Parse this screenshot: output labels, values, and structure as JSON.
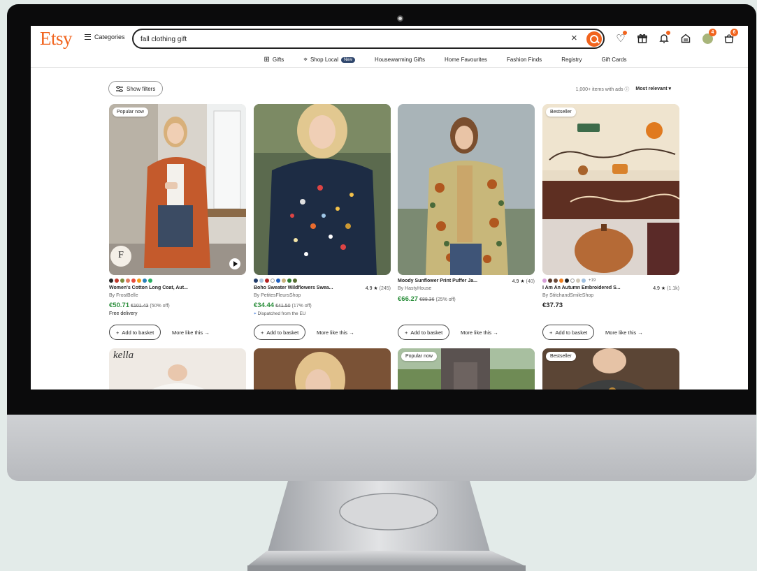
{
  "header": {
    "logo": "Etsy",
    "categories_label": "Categories",
    "search_value": "fall clothing gift",
    "clear_glyph": "×",
    "notif_badge": "4",
    "cart_badge": "6"
  },
  "nav": [
    {
      "label": "Gifts",
      "icon": "gift-icon"
    },
    {
      "label": "Shop Local",
      "icon": "location-pin-icon",
      "pill": "New"
    },
    {
      "label": "Housewarming Gifts"
    },
    {
      "label": "Home Favourites"
    },
    {
      "label": "Fashion Finds"
    },
    {
      "label": "Registry"
    },
    {
      "label": "Gift Cards"
    }
  ],
  "toolbar": {
    "filters_label": "Show filters",
    "results_text": "1,000+ items with ads ⓘ",
    "sort_label": "Most relevant ▾"
  },
  "buttons": {
    "add_label": "Add to basket",
    "more_label": "More like this →"
  },
  "products": [
    {
      "tag": "Popular now",
      "title": "Women's Cotton Long Coat, Aut...",
      "rating": "",
      "count": "",
      "shop": "By FrostBelle",
      "price": "€50.71",
      "old_price": "€101.43",
      "discount": "(50% off)",
      "extra": "Free delivery",
      "seal_letter": "F",
      "swatches": [
        "#222222",
        "#c0392b",
        "#7a8b3d",
        "#e07a5f",
        "#e74c3c",
        "#f39c12",
        "#2980b9",
        "#27ae60"
      ]
    },
    {
      "tag": "",
      "title": "Boho Sweater Wildflowers Swea...",
      "rating": "4.9 ★",
      "count": "(245)",
      "shop": "By PetitesFleursShop",
      "price": "€34.44",
      "old_price": "€41.50",
      "discount": "(17% off)",
      "extra": "Dispatched from the EU",
      "swatches": [
        "#1f3a68",
        "#a8c6e0",
        "#b22222",
        "#ffffff",
        "#1e5fbf",
        "#c9b27c",
        "#2e7d32",
        "#556b2f"
      ]
    },
    {
      "tag": "",
      "title": "Moody Sunflower Print Puffer Ja...",
      "rating": "4.9 ★",
      "count": "(40)",
      "shop": "By HastyHouse",
      "price": "€66.27",
      "old_price": "€88.36",
      "discount": "(25% off)",
      "extra": "",
      "swatches": []
    },
    {
      "tag": "Bestseller",
      "title": "I Am An Autumn Embroidered S...",
      "rating": "4.9 ★",
      "count": "(1.1k)",
      "shop": "By StitchandSmileShop",
      "price": "€37.73",
      "old_price": "",
      "discount": "",
      "extra": "",
      "swatches": [
        "#d8a0d8",
        "#5a3a2a",
        "#6b4a3a",
        "#f08020",
        "#222222",
        "#ffffff",
        "#d0c8b8",
        "#a0c0e0"
      ],
      "swatch_more": "+19"
    }
  ],
  "row2_tags": [
    "",
    "",
    "Popular now",
    "Bestseller"
  ],
  "row2_script": "kella"
}
